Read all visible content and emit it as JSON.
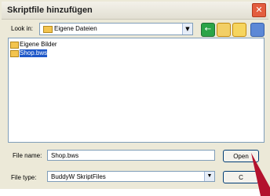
{
  "dialog": {
    "title": "Skriptfile hinzufügen",
    "lookin_label": "Look in:",
    "lookin_value": "Eigene Dateien"
  },
  "toolbar": {
    "icons": [
      "back-icon",
      "up-folder-icon",
      "new-folder-icon",
      "view-menu-icon"
    ]
  },
  "files": [
    {
      "name": "Eigene Bilder",
      "type": "folder",
      "selected": false
    },
    {
      "name": "Shop.bws",
      "type": "file",
      "selected": true
    }
  ],
  "form": {
    "file_name_label": "File name:",
    "file_name_value": "Shop.bws",
    "file_type_label": "File type:",
    "file_type_value": "BuddyW SkriptFiles"
  },
  "buttons": {
    "open": "Open",
    "cancel": "C"
  },
  "colors": {
    "selection": "#1f58c8",
    "close": "#e35d3f",
    "pointer": "#b3122e"
  }
}
